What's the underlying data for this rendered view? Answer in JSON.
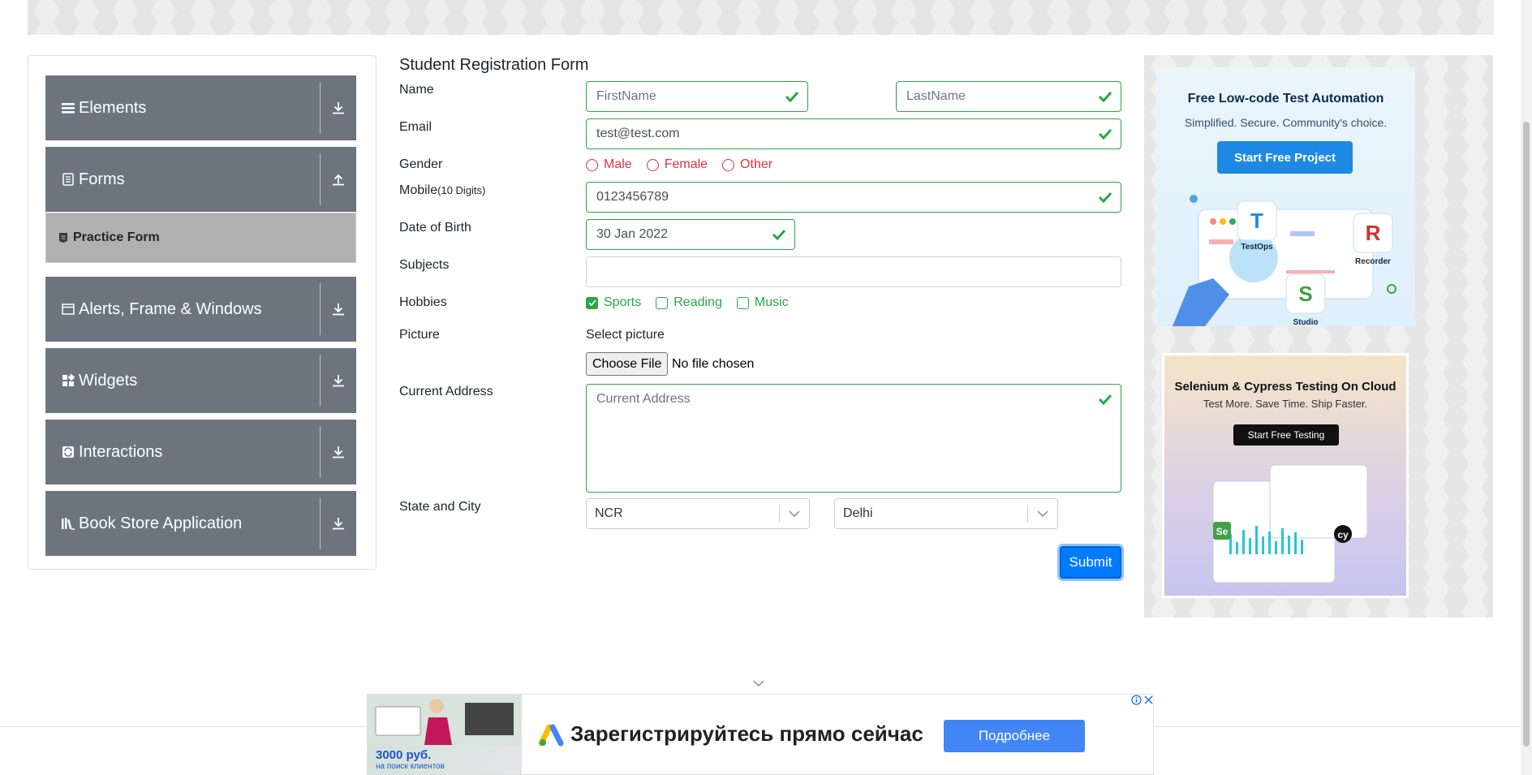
{
  "sidebar": {
    "groups": [
      {
        "label": "Elements",
        "icon": "list-icon",
        "arrow": "download-icon"
      },
      {
        "label": "Forms",
        "icon": "document-icon",
        "arrow": "upload-icon"
      },
      {
        "label": "Alerts, Frame & Windows",
        "icon": "window-icon",
        "arrow": "download-icon"
      },
      {
        "label": "Widgets",
        "icon": "widgets-icon",
        "arrow": "download-icon"
      },
      {
        "label": "Interactions",
        "icon": "interaction-icon",
        "arrow": "download-icon"
      },
      {
        "label": "Book Store Application",
        "icon": "books-icon",
        "arrow": "download-icon"
      }
    ],
    "active_item": "Practice Form"
  },
  "form": {
    "title": "Student Registration Form",
    "labels": {
      "name": "Name",
      "email": "Email",
      "gender": "Gender",
      "mobile": "Mobile",
      "mobile_hint": "(10 Digits)",
      "dob": "Date of Birth",
      "subjects": "Subjects",
      "hobbies": "Hobbies",
      "picture": "Picture",
      "address": "Current Address",
      "state_city": "State and City"
    },
    "first_name_placeholder": "FirstName",
    "last_name_placeholder": "LastName",
    "email_value": "test@test.com",
    "gender_options": [
      "Male",
      "Female",
      "Other"
    ],
    "mobile_value": "0123456789",
    "dob_value": "30 Jan 2022",
    "subjects_value": "",
    "hobbies": [
      {
        "label": "Sports",
        "checked": true
      },
      {
        "label": "Reading",
        "checked": false
      },
      {
        "label": "Music",
        "checked": false
      }
    ],
    "picture_label": "Select picture",
    "choose_file_label": "Choose File",
    "no_file_text": "No file chosen",
    "address_placeholder": "Current Address",
    "state_value": "NCR",
    "city_value": "Delhi",
    "submit_label": "Submit",
    "valid_color": "#28a745",
    "invalid_color": "#dc3545"
  },
  "ads": {
    "ad1": {
      "headline": "Free Low-code Test Automation",
      "subline": "Simplified. Secure. Community's choice.",
      "button": "Start Free Project",
      "labels": [
        "TestOps",
        "Recorder",
        "Studio"
      ]
    },
    "ad2": {
      "headline": "Selenium & Cypress Testing On Cloud",
      "subline": "Test More. Save Time. Ship Faster.",
      "button": "Start Free Testing"
    },
    "bottom": {
      "price": "3000 руб.",
      "price_sub": "на поиск клиентов",
      "headline": "Зарегистрируйтесь прямо сейчас",
      "cta": "Подробнее"
    }
  }
}
